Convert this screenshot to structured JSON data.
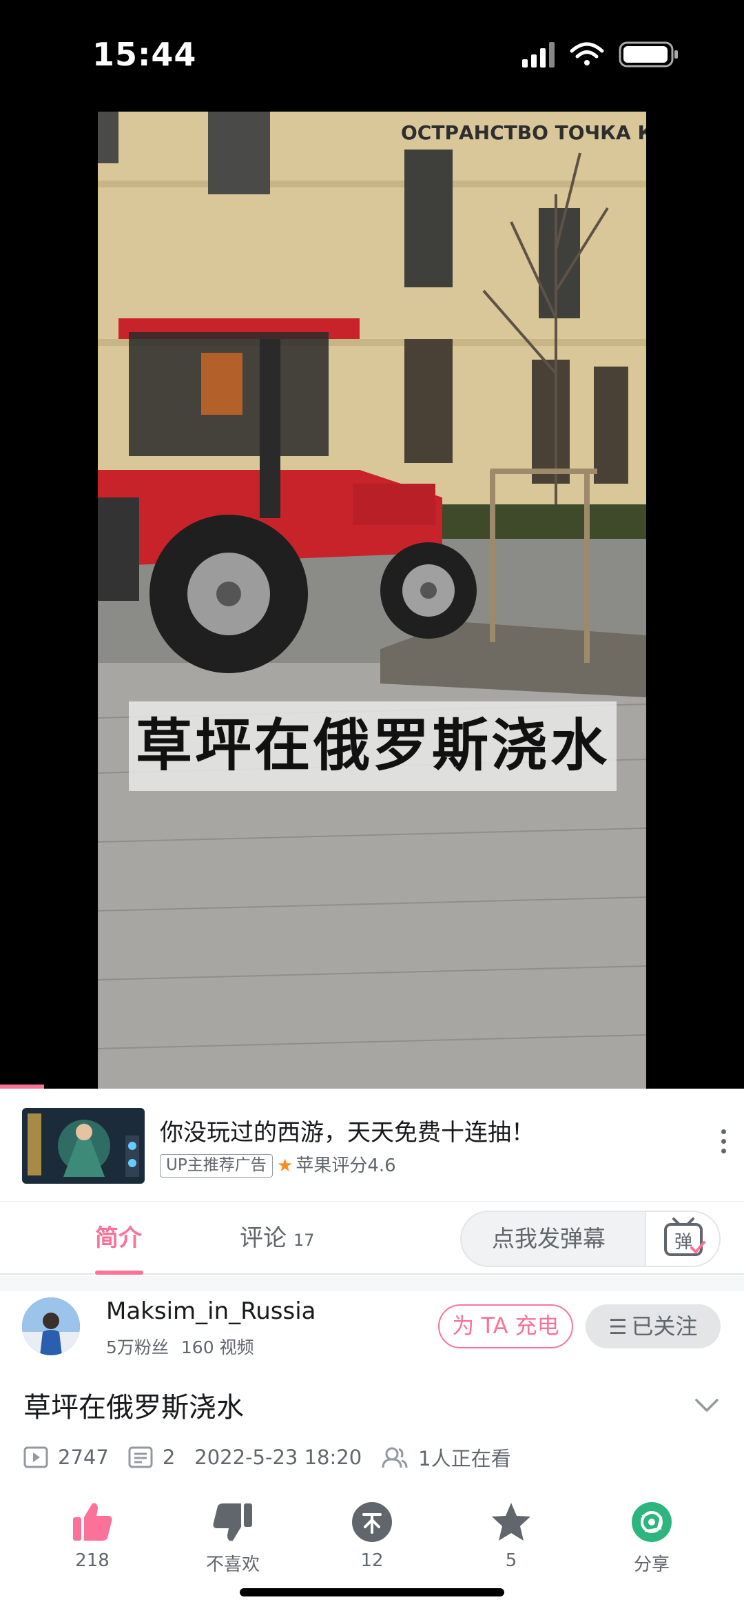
{
  "status_bar": {
    "time": "15:44"
  },
  "video": {
    "caption": "草坪在俄罗斯浇水"
  },
  "ad": {
    "title": "你没玩过的西游，天天免费十连抽！",
    "tag": "UP主推荐广告",
    "rating": "苹果评分4.6"
  },
  "tabs": {
    "intro": "简介",
    "comments": "评论",
    "comments_count": "17",
    "danmaku_placeholder": "点我发弹幕",
    "danmaku_icon_char": "弹"
  },
  "uploader": {
    "name": "Maksim_in_Russia",
    "fans": "5万粉丝",
    "videos": "160 视频",
    "charge_label": "为 TA 充电",
    "follow_label": "已关注"
  },
  "detail": {
    "title": "草坪在俄罗斯浇水",
    "plays": "2747",
    "danmaku_count": "2",
    "date": "2022-5-23 18:20",
    "watching": "1人正在看"
  },
  "actions": {
    "like": "218",
    "dislike": "不喜欢",
    "coin": "12",
    "favorite": "5",
    "share": "分享"
  },
  "colors": {
    "accent": "#fb7299",
    "share": "#2cb67d",
    "muted": "#61666d"
  },
  "icons": [
    "signal-icon",
    "wifi-icon",
    "battery-icon",
    "more-icon",
    "danmaku-toggle-icon",
    "chevron-down-icon",
    "play-count-icon",
    "danmaku-count-icon",
    "watching-icon",
    "like-icon",
    "dislike-icon",
    "coin-icon",
    "favorite-icon",
    "share-icon"
  ]
}
